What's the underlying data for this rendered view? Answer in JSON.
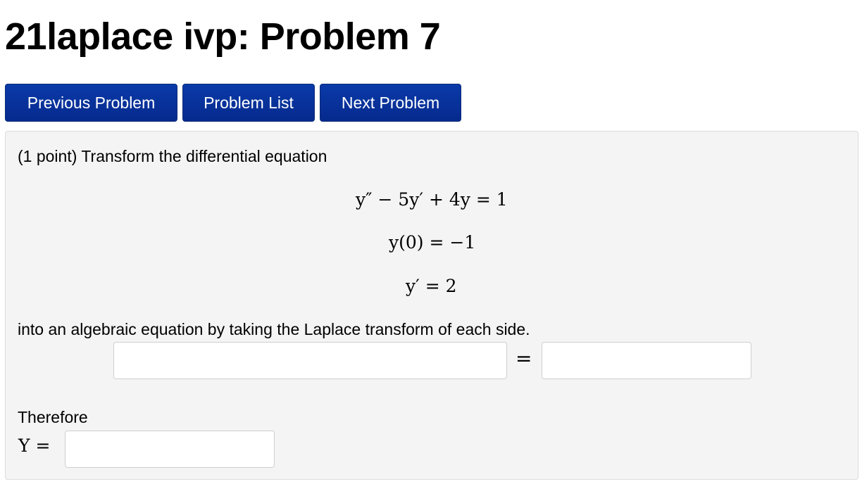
{
  "page": {
    "title": "21laplace ivp: Problem 7"
  },
  "nav": {
    "previous_label": "Previous Problem",
    "list_label": "Problem List",
    "next_label": "Next Problem"
  },
  "problem": {
    "intro": "(1 point) Transform the differential equation",
    "equations": [
      "y″ − 5y′ + 4y = 1",
      "y(0) = −1",
      "y′ = 2"
    ],
    "outro": "into an algebraic equation by taking the Laplace transform of each side.",
    "equals": "=",
    "therefore": "Therefore",
    "y_label": "Y ="
  },
  "inputs": {
    "left_value": "",
    "right_value": "",
    "y_value": ""
  },
  "colors": {
    "button_bg": "#062a8e",
    "button_text": "#ffffff",
    "box_bg": "#f4f4f4"
  }
}
